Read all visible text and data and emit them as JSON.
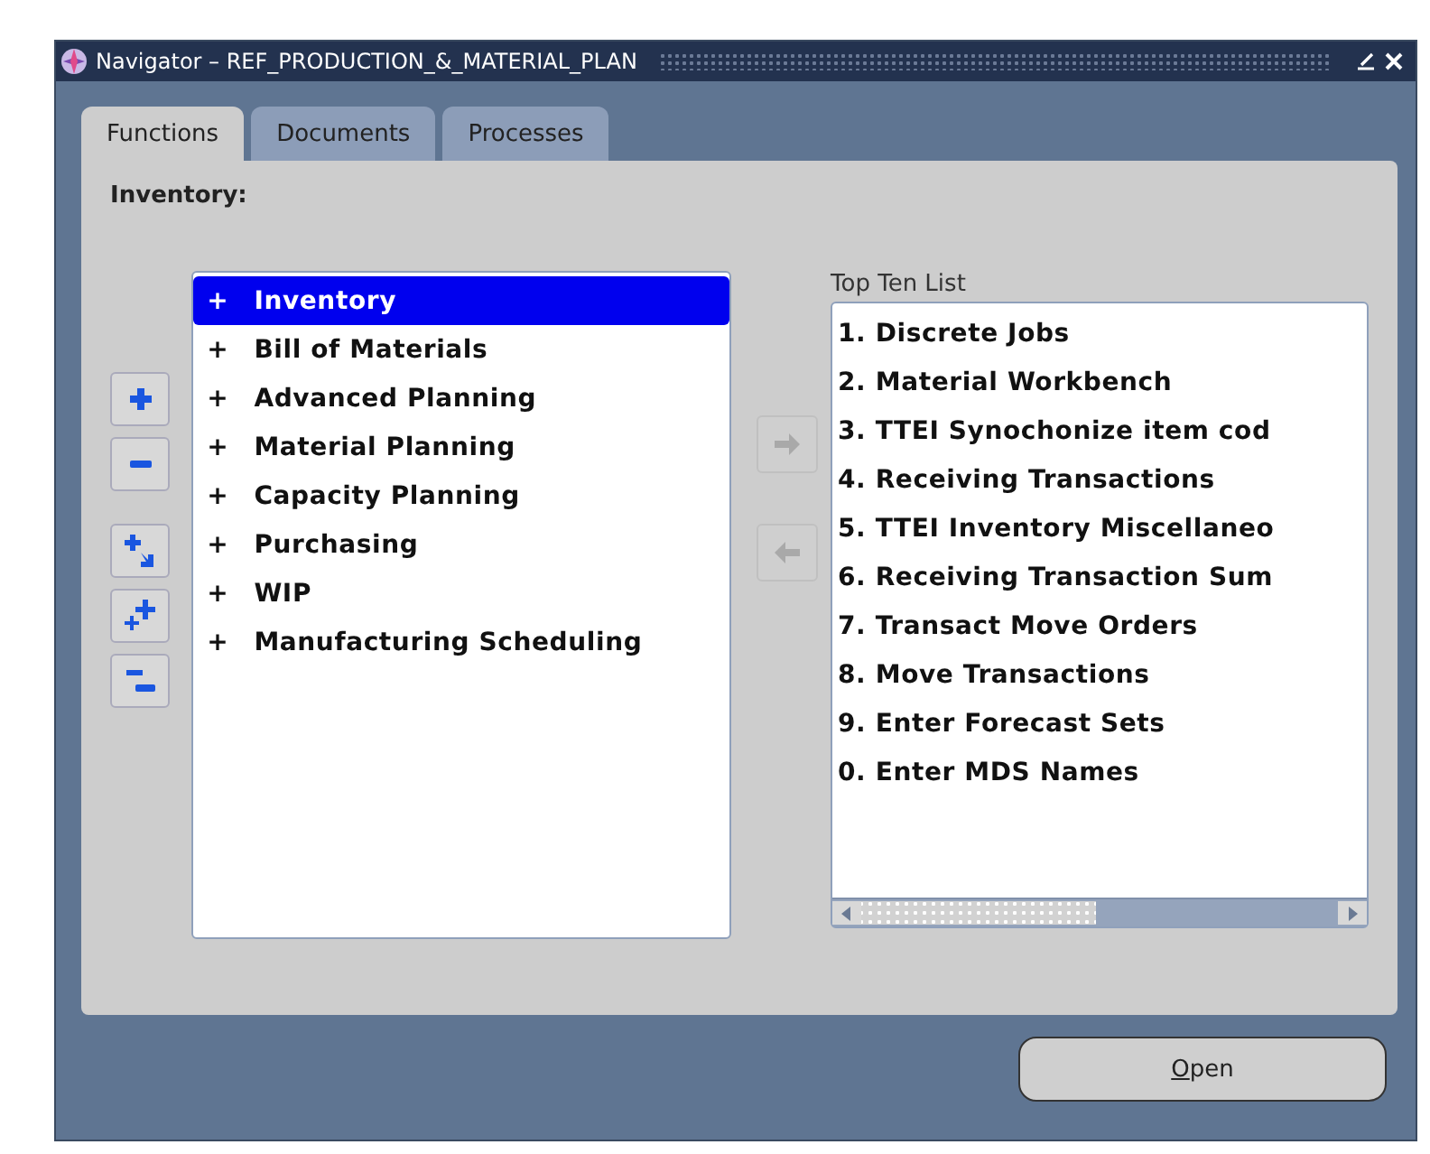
{
  "window": {
    "title": "Navigator – REF_PRODUCTION_&_MATERIAL_PLAN"
  },
  "tabs": [
    {
      "label": "Functions",
      "selected": true
    },
    {
      "label": "Documents",
      "selected": false
    },
    {
      "label": "Processes",
      "selected": false
    }
  ],
  "heading": "Inventory:",
  "tree_tools": [
    {
      "kind": "expand"
    },
    {
      "kind": "collapse"
    },
    {
      "kind": "expand_branch"
    },
    {
      "kind": "expand_all"
    },
    {
      "kind": "collapse_all"
    }
  ],
  "function_list": [
    {
      "expander": "+",
      "label": "Inventory",
      "selected": true
    },
    {
      "expander": "+",
      "label": "Bill of Materials",
      "selected": false
    },
    {
      "expander": "+",
      "label": "Advanced Planning",
      "selected": false
    },
    {
      "expander": "+",
      "label": "Material Planning",
      "selected": false
    },
    {
      "expander": "+",
      "label": "Capacity Planning",
      "selected": false
    },
    {
      "expander": "+",
      "label": "Purchasing",
      "selected": false
    },
    {
      "expander": "+",
      "label": "WIP",
      "selected": false
    },
    {
      "expander": "+",
      "label": "Manufacturing Scheduling",
      "selected": false
    }
  ],
  "transfer_buttons": [
    {
      "kind": "add",
      "disabled": true
    },
    {
      "kind": "remove",
      "disabled": true
    }
  ],
  "top_ten": {
    "label": "Top Ten List",
    "items": [
      "1. Discrete Jobs",
      "2. Material Workbench",
      "3. TTEI Synochonize item cod",
      "4. Receiving Transactions",
      "5. TTEI Inventory Miscellaneo",
      "6. Receiving Transaction Sum",
      "7. Transact Move Orders",
      "8. Move Transactions",
      "9. Enter Forecast Sets",
      "0. Enter MDS Names"
    ]
  },
  "buttons": [
    {
      "label": "Open"
    }
  ]
}
